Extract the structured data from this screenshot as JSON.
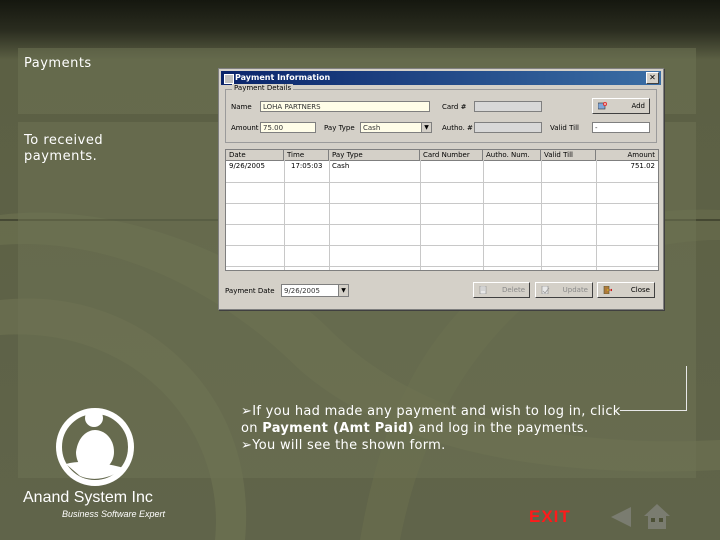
{
  "slide": {
    "title": "Payments",
    "subtitle": "To received payments.",
    "bullets": [
      {
        "pre": "If you had made any payment and wish to log in, click on ",
        "bold": "Payment (Amt Paid)",
        "post": " and log in the payments."
      },
      {
        "text": "You will see the shown form."
      }
    ]
  },
  "window": {
    "title": "Payment Information",
    "close_glyph": "✕",
    "group_label": "Payment Details",
    "fields": {
      "name_label": "Name",
      "name_value": "LOHA PARTNERS",
      "card_label": "Card #",
      "card_value": "",
      "amount_label": "Amount",
      "amount_value": "75.00",
      "pay_type_label": "Pay Type",
      "pay_type_value": "Cash",
      "autho_label": "Autho. #",
      "autho_value": "",
      "valid_till_label": "Valid Till",
      "valid_till_value": "-"
    },
    "add_button": "Add",
    "table": {
      "columns": [
        "Date",
        "Time",
        "Pay Type",
        "Card Number",
        "Autho. Num.",
        "Valid Till",
        "Amount"
      ],
      "rows": [
        [
          "9/26/2005",
          "17:05:03",
          "Cash",
          "",
          "",
          "",
          "751.02"
        ]
      ]
    },
    "payment_date_label": "Payment Date",
    "payment_date_value": "9/26/2005",
    "buttons": {
      "delete": "Delete",
      "update": "Update",
      "close": "Close"
    }
  },
  "branding": {
    "company": "Anand System Inc",
    "tagline": "Business Software Expert"
  },
  "navigation": {
    "exit": "EXIT",
    "back_icon": "triangle-left",
    "home_icon": "house"
  },
  "colors": {
    "exit": "#ff1a1a",
    "titlebar_start": "#0a246a",
    "titlebar_end": "#3a6ea5"
  }
}
